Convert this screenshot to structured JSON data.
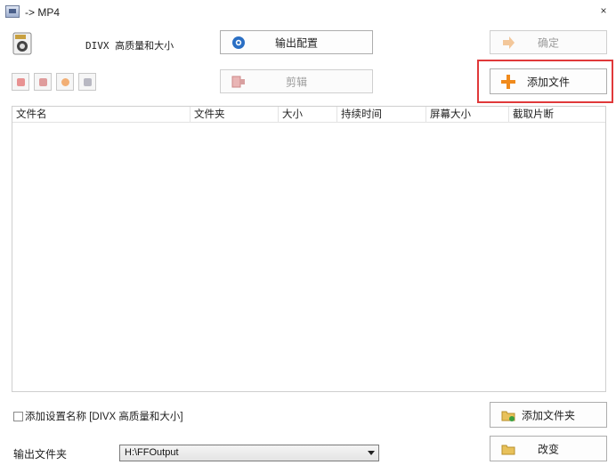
{
  "window": {
    "title": "-> MP4",
    "close_glyph": "×"
  },
  "preset": {
    "icon": "divx-preset-icon",
    "name": "DIVX 高质量和大小"
  },
  "toolbar": {
    "output_config_label": "输出配置",
    "output_config_icon": "gear-globe-icon",
    "edit_label": "剪辑",
    "edit_icon": "film-cut-icon",
    "ok_label": "确定",
    "ok_icon": "arrow-right-icon",
    "add_file_label": "添加文件",
    "add_file_icon": "plus-icon"
  },
  "small_tools": [
    {
      "name": "remove-icon",
      "color": "#e05050"
    },
    {
      "name": "clear-icon",
      "color": "#d06060"
    },
    {
      "name": "play-icon",
      "color": "#f08020"
    },
    {
      "name": "info-icon",
      "color": "#9090a0"
    }
  ],
  "table": {
    "columns": [
      "文件名",
      "文件夹",
      "大小",
      "持续时间",
      "屏幕大小",
      "截取片断"
    ]
  },
  "footer": {
    "checkbox_label": "添加设置名称 [DIVX 高质量和大小]",
    "checkbox_checked": false,
    "add_folder_label": "添加文件夹",
    "add_folder_icon": "folder-add-icon",
    "output_folder_label": "输出文件夹",
    "output_folder_value": "H:\\FFOutput",
    "change_label": "改变",
    "change_icon": "folder-icon"
  },
  "colors": {
    "highlight": "#e0393a",
    "accent_orange": "#f08a1c"
  }
}
